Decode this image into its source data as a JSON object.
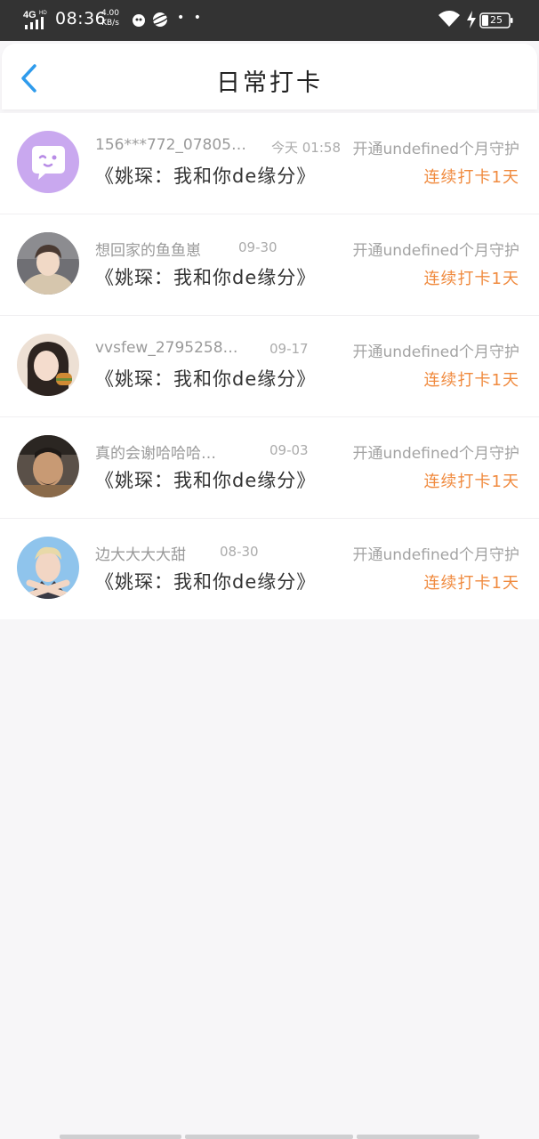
{
  "status_bar": {
    "network": "4G",
    "network_sup": "HD",
    "time": "08:36",
    "speed_value": "4.00",
    "speed_unit": "KB/s",
    "dots": "• •",
    "battery": "25"
  },
  "header": {
    "title": "日常打卡"
  },
  "colors": {
    "accent_blue": "#2f9bec",
    "streak_orange": "#f08a3e",
    "muted_gray": "#a3a3a3"
  },
  "records": [
    {
      "user": "156***772_07805…",
      "date": "今天 01:58",
      "action": "开通undefined个月守护",
      "book": "《姚琛：我和你de缘分》",
      "streak": "连续打卡1天",
      "avatar": "cartoon-chat-avatar"
    },
    {
      "user": "想回家的鱼鱼崽",
      "date": "09-30",
      "action": "开通undefined个月守护",
      "book": "《姚琛：我和你de缘分》",
      "streak": "连续打卡1天",
      "avatar": "person-photo-avatar"
    },
    {
      "user": "vvsfew_2795258…",
      "date": "09-17",
      "action": "开通undefined个月守护",
      "book": "《姚琛：我和你de缘分》",
      "streak": "连续打卡1天",
      "avatar": "person-photo-avatar"
    },
    {
      "user": "真的会谢哈哈哈…",
      "date": "09-03",
      "action": "开通undefined个月守护",
      "book": "《姚琛：我和你de缘分》",
      "streak": "连续打卡1天",
      "avatar": "person-photo-avatar"
    },
    {
      "user": "边大大大大甜",
      "date": "08-30",
      "action": "开通undefined个月守护",
      "book": "《姚琛：我和你de缘分》",
      "streak": "连续打卡1天",
      "avatar": "person-photo-avatar"
    }
  ]
}
